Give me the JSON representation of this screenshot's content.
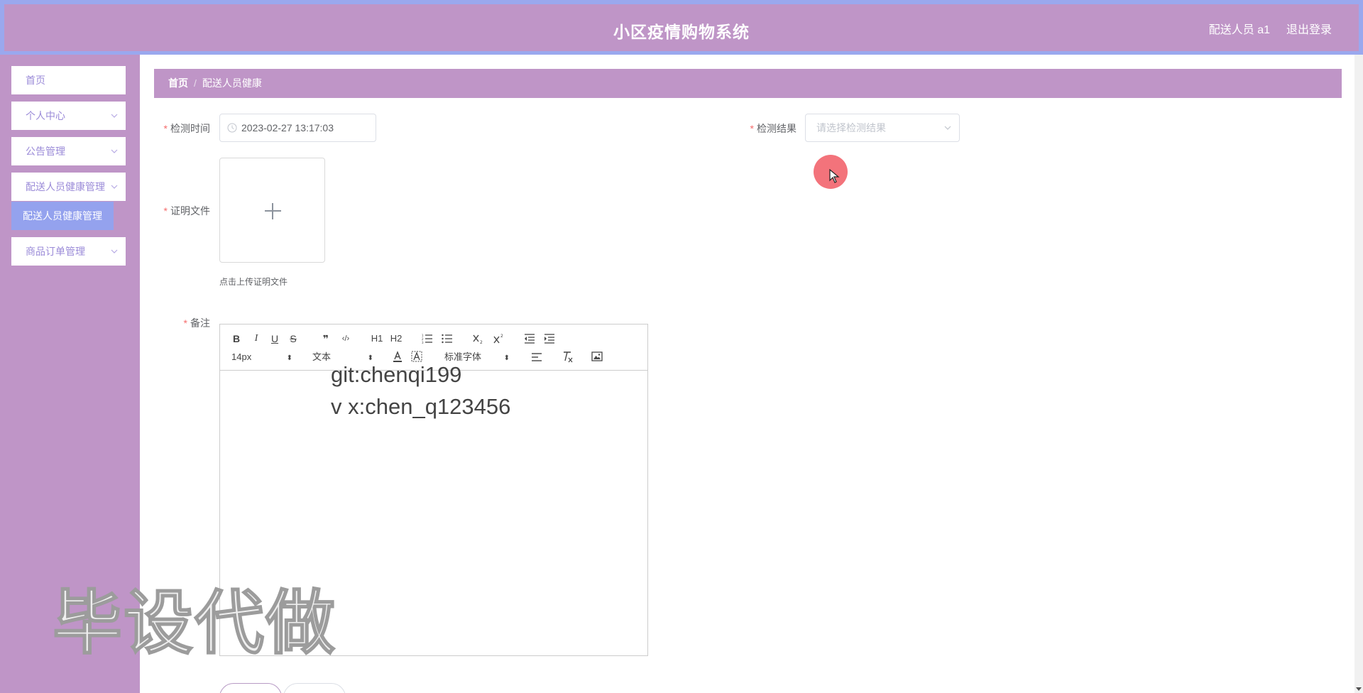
{
  "header": {
    "title": "小区疫情购物系统",
    "user": "配送人员 a1",
    "logout": "退出登录"
  },
  "sidebar": {
    "items": [
      {
        "label": "首页",
        "has_chevron": false
      },
      {
        "label": "个人中心",
        "has_chevron": true
      },
      {
        "label": "公告管理",
        "has_chevron": true
      },
      {
        "label": "配送人员健康管理",
        "has_chevron": true
      },
      {
        "label": "商品订单管理",
        "has_chevron": true
      }
    ],
    "submenu_active": "配送人员健康管理"
  },
  "breadcrumb": {
    "home": "首页",
    "separator": "/",
    "current": "配送人员健康"
  },
  "form": {
    "check_time_label": "检测时间",
    "check_time_value": "2023-02-27 13:17:03",
    "check_result_label": "检测结果",
    "check_result_placeholder": "请选择检测结果",
    "proof_file_label": "证明文件",
    "upload_tip": "点击上传证明文件",
    "remark_label": "备注",
    "required_mark": "*"
  },
  "editor": {
    "toolbar": {
      "bold": "B",
      "italic": "I",
      "underline": "U",
      "strike": "S",
      "quote": "❞",
      "code": "‹/›",
      "h1": "H1",
      "h2": "H2",
      "font_size": "14px",
      "text_type": "文本",
      "font_family": "标准字体"
    },
    "content_lines": [
      "git:chenqi199",
      "v x:chen_q123456"
    ]
  },
  "watermark": "毕设代做",
  "colors": {
    "header_bg": "#bf95c7",
    "header_border": "#9aa8ee",
    "sidebar_bg": "#bf95c7",
    "menu_text": "#9b8bd8",
    "submenu_active_bg": "#94a2ee",
    "required": "#f56c6c"
  }
}
